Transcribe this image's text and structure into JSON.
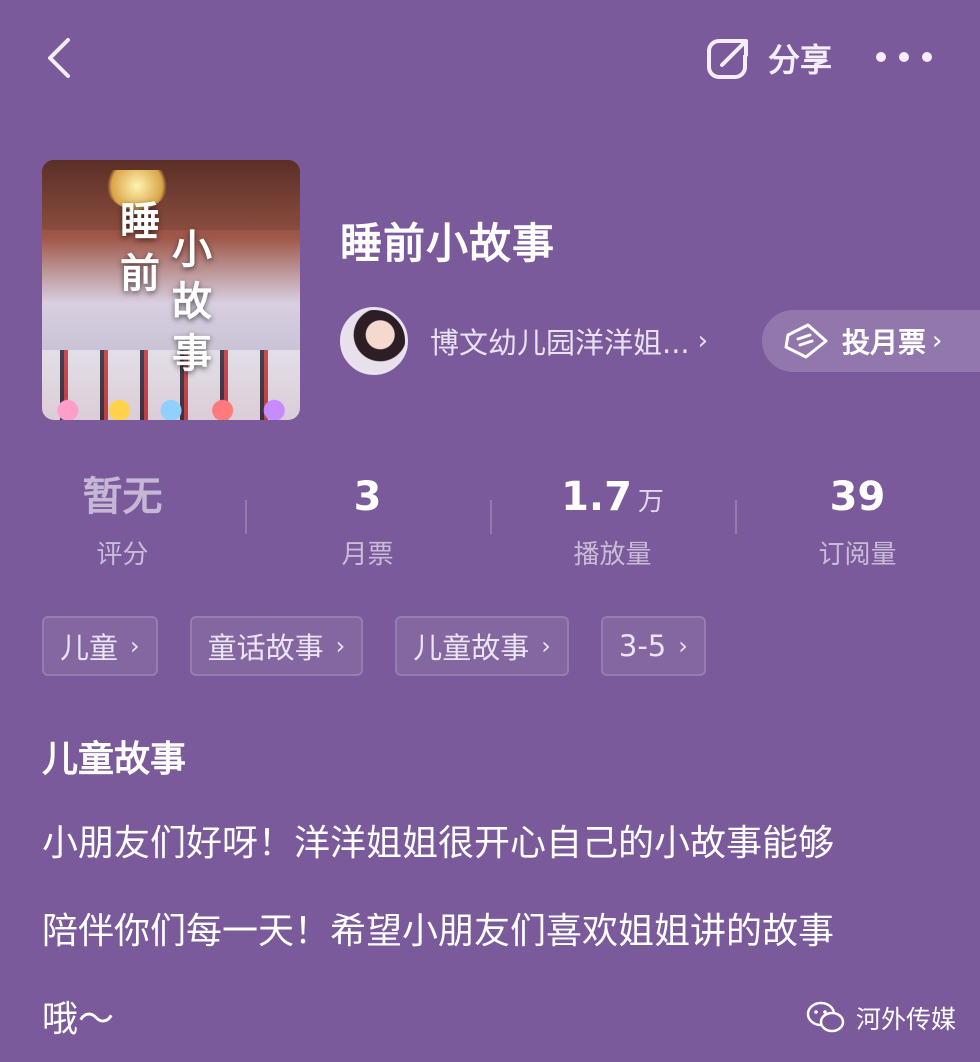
{
  "header": {
    "share_label": "分享"
  },
  "album": {
    "cover_text_col1": "睡前",
    "cover_text_col2": "小故事",
    "title": "睡前小故事",
    "author_name": "博文幼儿园洋洋姐...",
    "vote_label": "投月票"
  },
  "stats": [
    {
      "value": "暂无",
      "unit": "",
      "label": "评分"
    },
    {
      "value": "3",
      "unit": "",
      "label": "月票"
    },
    {
      "value": "1.7",
      "unit": "万",
      "label": "播放量"
    },
    {
      "value": "39",
      "unit": "",
      "label": "订阅量"
    }
  ],
  "tags": [
    "儿童",
    "童话故事",
    "儿童故事",
    "3-5"
  ],
  "description": {
    "title": "儿童故事",
    "lines": [
      "小朋友们好呀！洋洋姐姐很开心自己的小故事能够",
      "陪伴你们每一天！希望小朋友们喜欢姐姐讲的故事",
      "哦～"
    ]
  },
  "watermark": {
    "text": "河外传媒"
  },
  "icons": {
    "back": "chevron-left-icon",
    "share": "share-icon",
    "more": "more-dots-icon",
    "vote": "ticket-icon",
    "watermark": "wechat-icon"
  }
}
